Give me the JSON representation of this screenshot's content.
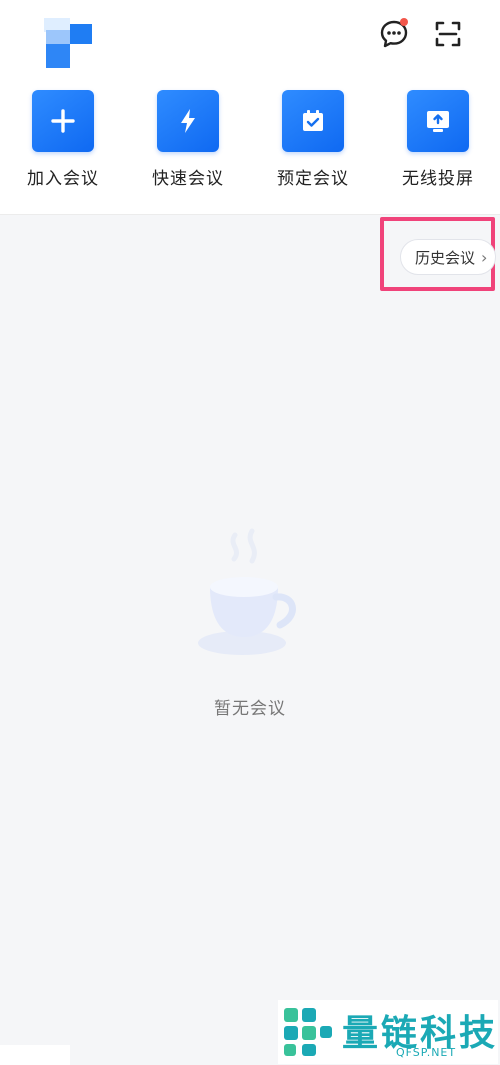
{
  "actions": [
    {
      "label": "加入会议",
      "icon": "plus-icon"
    },
    {
      "label": "快速会议",
      "icon": "lightning-icon"
    },
    {
      "label": "预定会议",
      "icon": "calendar-check-icon"
    },
    {
      "label": "无线投屏",
      "icon": "screen-cast-icon"
    }
  ],
  "header": {
    "logo": "app-logo",
    "message_icon": "chat-bubble-icon",
    "scan_icon": "scan-icon",
    "message_has_badge": true
  },
  "history": {
    "label": "历史会议",
    "icon": "chevron-right-icon"
  },
  "empty_state": {
    "text": "暂无会议",
    "icon": "coffee-cup-icon"
  },
  "watermark": {
    "text": "量链科技",
    "sub": "QFSP.NET"
  },
  "colors": {
    "accent": "#1570ef",
    "badge": "#f2564a",
    "highlight_border": "#f0437a",
    "watermark": "#1ba9b5"
  }
}
